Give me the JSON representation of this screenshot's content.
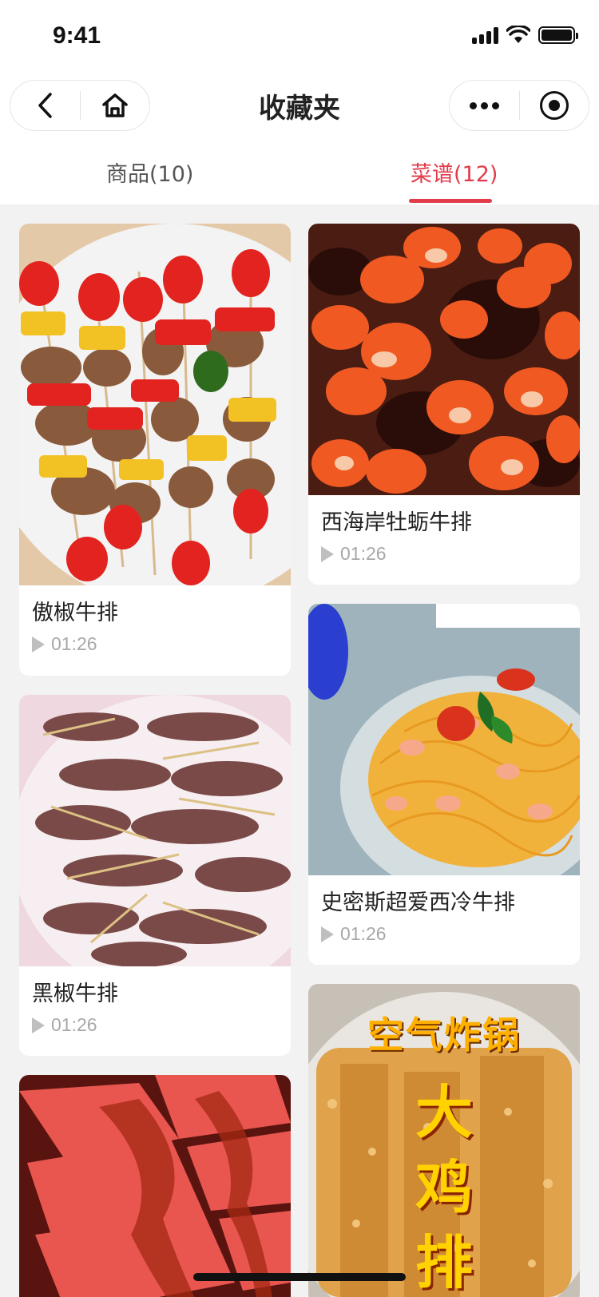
{
  "status_bar": {
    "time": "9:41"
  },
  "nav": {
    "title": "收藏夹"
  },
  "tabs": [
    {
      "label": "商品(10)",
      "active": false
    },
    {
      "label": "菜谱(12)",
      "active": true
    }
  ],
  "colors": {
    "accent": "#e23c4a",
    "background": "#f2f2f2"
  },
  "recipes": [
    {
      "title": "傲椒牛排",
      "duration": "01:26"
    },
    {
      "title": "西海岸牡蛎牛排",
      "duration": "01:26"
    },
    {
      "title": "黑椒牛排",
      "duration": "01:26"
    },
    {
      "title": "史密斯超爱西冷牛排",
      "duration": "01:26"
    }
  ],
  "thumbnail_texts": {
    "air_fryer": "空气炸锅",
    "chicken_1": "大",
    "chicken_2": "鸡",
    "chicken_3": "排"
  }
}
